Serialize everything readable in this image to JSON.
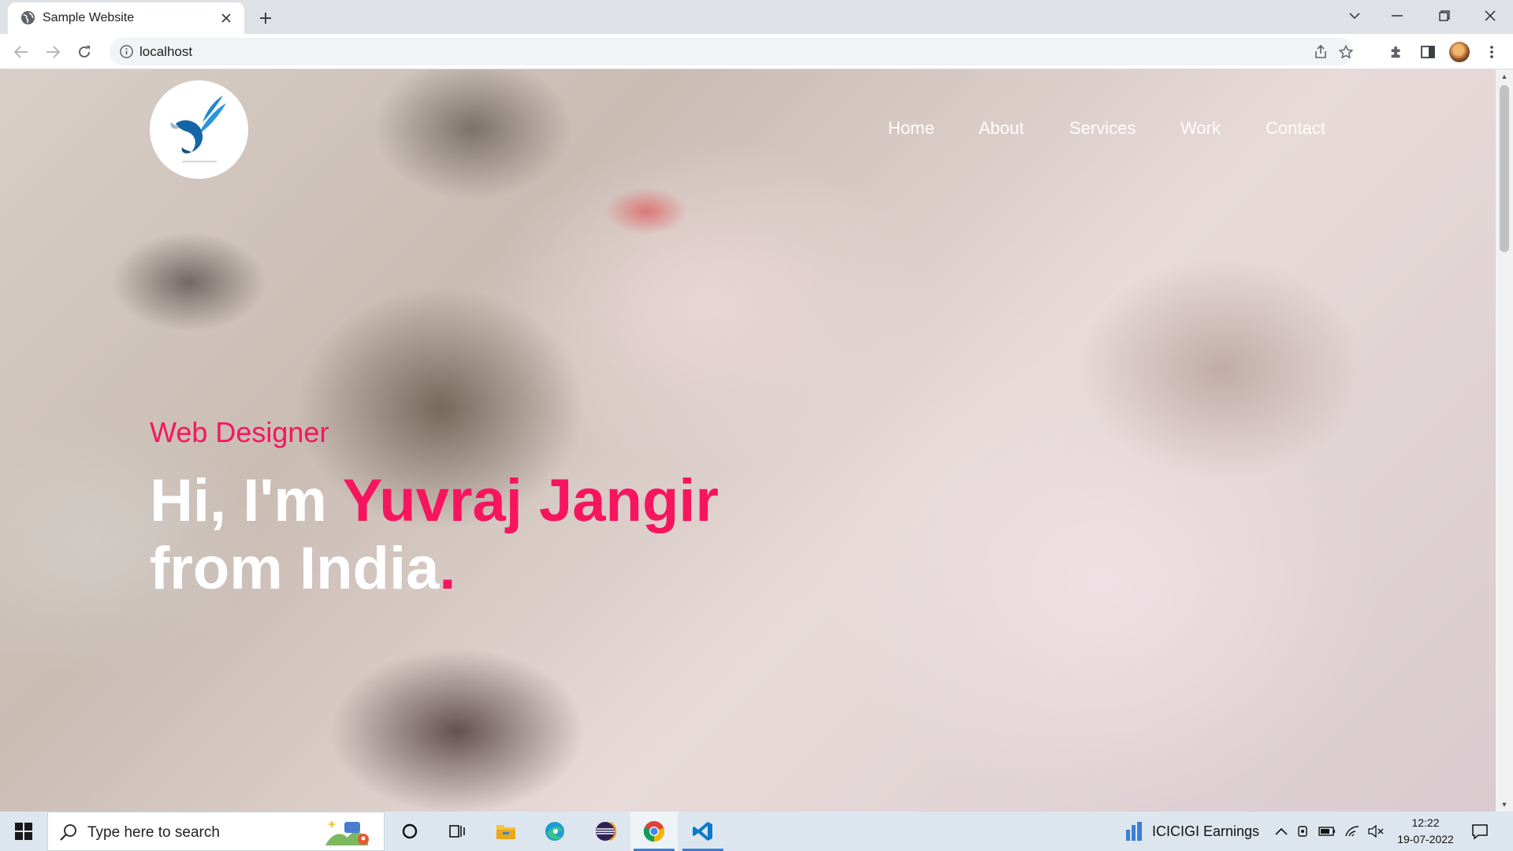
{
  "browser": {
    "tab_title": "Sample Website",
    "url": "localhost"
  },
  "site": {
    "nav": [
      "Home",
      "About",
      "Services",
      "Work",
      "Contact"
    ],
    "hero": {
      "subtitle": "Web Designer",
      "line1_prefix": "Hi, I'm ",
      "line1_name": "Yuvraj Jangir",
      "line2": "from India",
      "line2_dot": "."
    },
    "accent_color": "#f7155f"
  },
  "taskbar": {
    "search_placeholder": "Type here to search",
    "news_text": "ICICIGI  Earnings",
    "time": "12:22",
    "date": "19-07-2022"
  }
}
